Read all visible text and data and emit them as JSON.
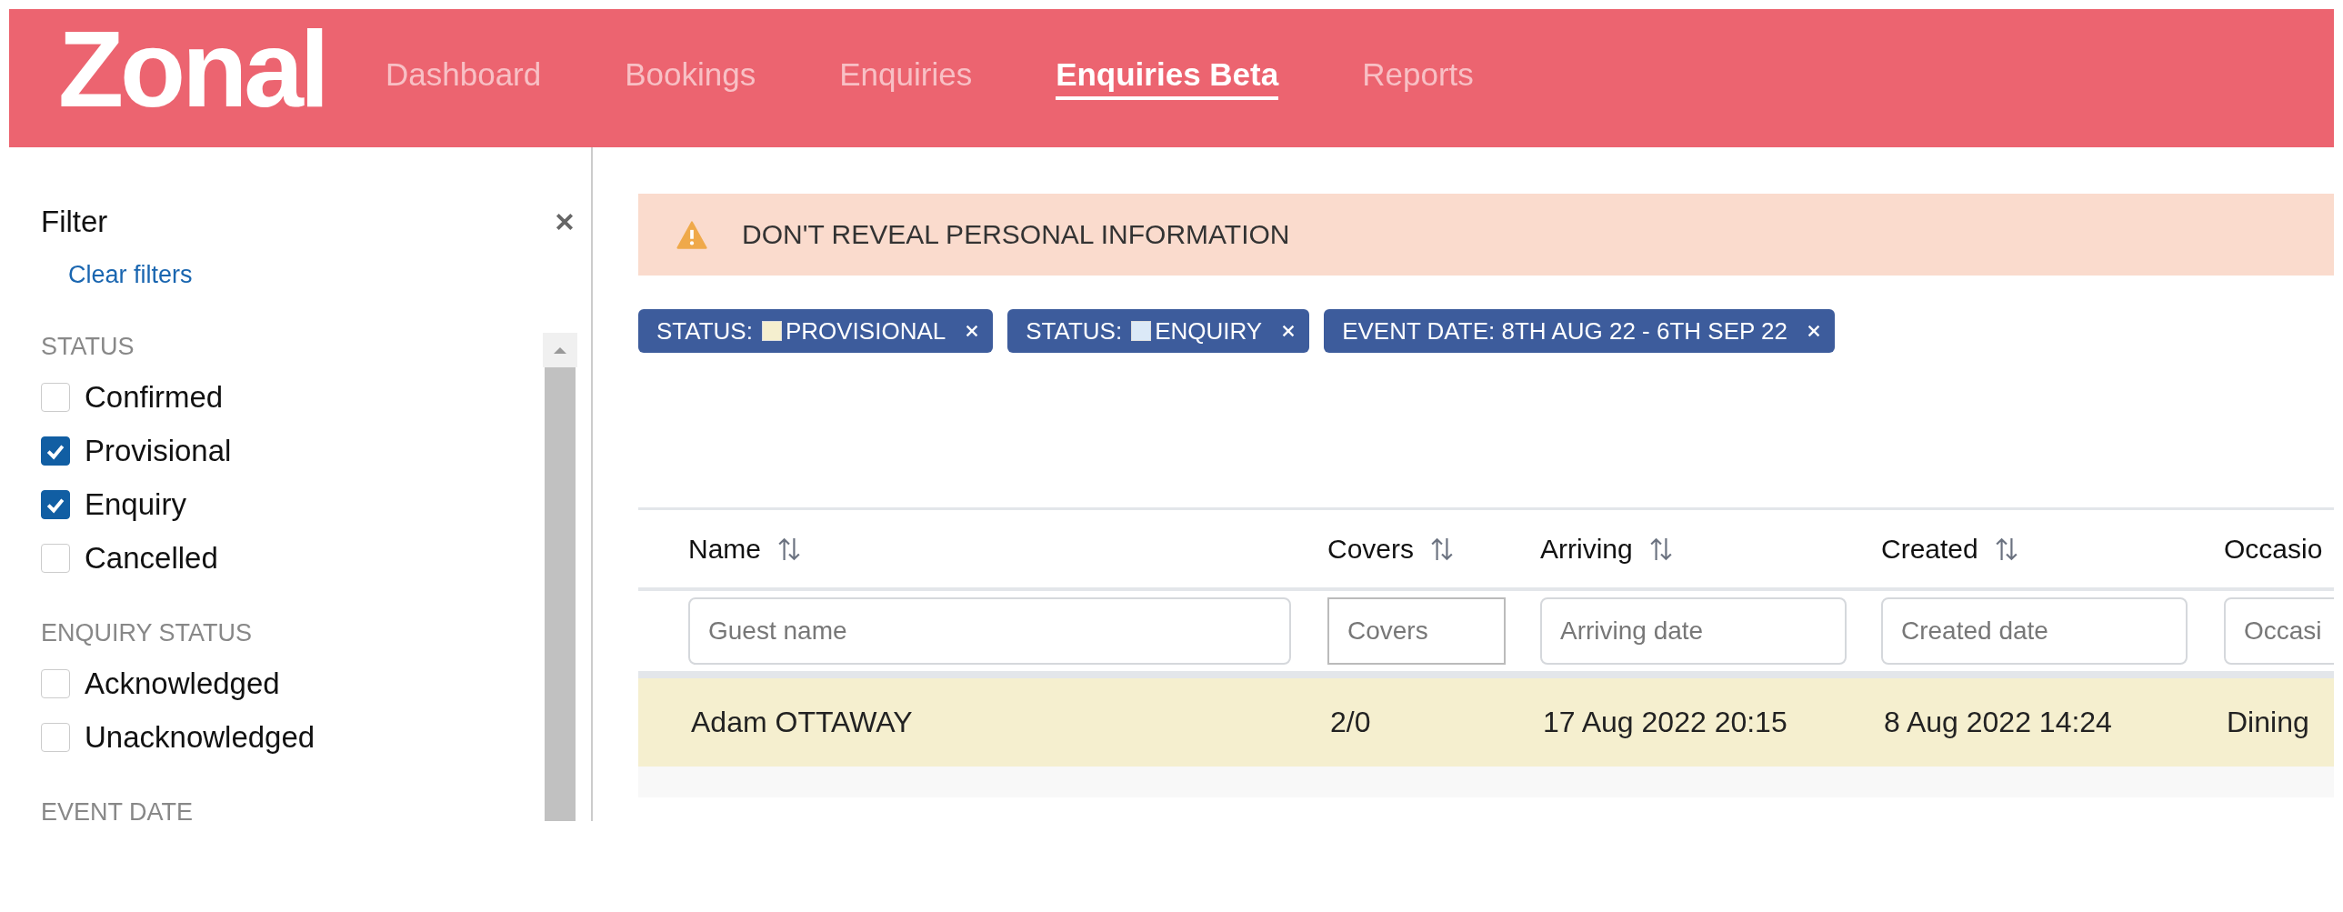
{
  "logo": "Zonal",
  "nav": [
    {
      "label": "Dashboard",
      "selected": false
    },
    {
      "label": "Bookings",
      "selected": false
    },
    {
      "label": "Enquiries",
      "selected": false
    },
    {
      "label": "Enquiries Beta",
      "selected": true
    },
    {
      "label": "Reports",
      "selected": false
    }
  ],
  "filter": {
    "title": "Filter",
    "clear": "Clear filters",
    "sections": [
      {
        "title": "STATUS",
        "options": [
          {
            "label": "Confirmed",
            "checked": false
          },
          {
            "label": "Provisional",
            "checked": true
          },
          {
            "label": "Enquiry",
            "checked": true
          },
          {
            "label": "Cancelled",
            "checked": false
          }
        ]
      },
      {
        "title": "ENQUIRY STATUS",
        "options": [
          {
            "label": "Acknowledged",
            "checked": false
          },
          {
            "label": "Unacknowledged",
            "checked": false
          }
        ]
      },
      {
        "title": "EVENT DATE"
      }
    ]
  },
  "banner": "DON'T REVEAL PERSONAL INFORMATION",
  "chips": [
    {
      "prefix": "STATUS:",
      "value": "PROVISIONAL",
      "color": "#f5efcf"
    },
    {
      "prefix": "STATUS:",
      "value": "ENQUIRY",
      "color": "#dbe9f7"
    },
    {
      "prefix": "EVENT DATE:",
      "value": "8TH AUG 22 - 6TH SEP 22"
    }
  ],
  "table": {
    "columns": [
      {
        "label": "Name",
        "placeholder": "Guest name"
      },
      {
        "label": "Covers",
        "placeholder": "Covers"
      },
      {
        "label": "Arriving",
        "placeholder": "Arriving date"
      },
      {
        "label": "Created",
        "placeholder": "Created date"
      },
      {
        "label": "Occasio",
        "placeholder": "Occasi"
      }
    ],
    "rows": [
      [
        "Adam OTTAWAY",
        "2/0",
        "17 Aug 2022 20:15",
        "8 Aug 2022 14:24",
        "Dining"
      ]
    ]
  }
}
